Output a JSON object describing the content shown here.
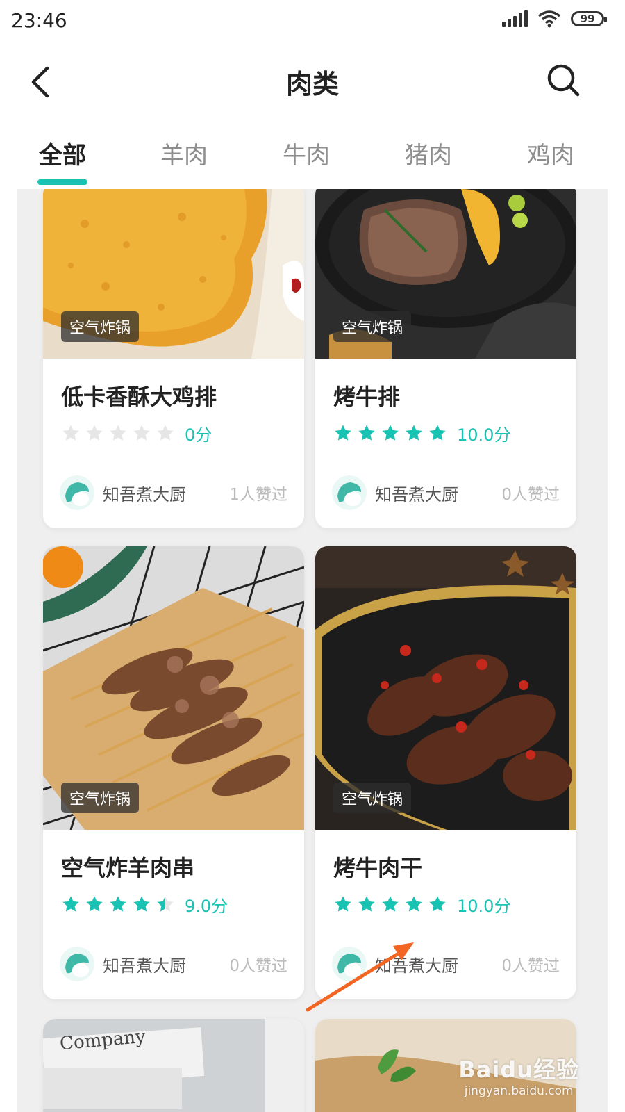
{
  "status_bar": {
    "time": "23:46",
    "battery": "99"
  },
  "header": {
    "title": "肉类",
    "back_icon": "chevron-left-icon",
    "search_icon": "search-icon"
  },
  "tabs": [
    {
      "label": "全部",
      "active": true
    },
    {
      "label": "羊肉",
      "active": false
    },
    {
      "label": "牛肉",
      "active": false
    },
    {
      "label": "猪肉",
      "active": false
    },
    {
      "label": "鸡肉",
      "active": false
    }
  ],
  "accent_color": "#19c2b2",
  "cards": [
    {
      "tag": "空气炸锅",
      "title": "低卡香酥大鸡排",
      "stars": 0,
      "score": "0分",
      "author": "知吾煮大厨",
      "likes": "1人赞过"
    },
    {
      "tag": "空气炸锅",
      "title": "烤牛排",
      "stars": 5,
      "score": "10.0分",
      "author": "知吾煮大厨",
      "likes": "0人赞过"
    },
    {
      "tag": "空气炸锅",
      "title": "空气炸羊肉串",
      "stars": 4.5,
      "score": "9.0分",
      "author": "知吾煮大厨",
      "likes": "0人赞过"
    },
    {
      "tag": "空气炸锅",
      "title": "烤牛肉干",
      "stars": 5,
      "score": "10.0分",
      "author": "知吾煮大厨",
      "likes": "0人赞过"
    }
  ],
  "partial_cards": [
    {
      "image_text": "Company"
    },
    {
      "image_text": ""
    }
  ],
  "watermark": {
    "brand": "Baidu经验",
    "url": "jingyan.baidu.com"
  }
}
